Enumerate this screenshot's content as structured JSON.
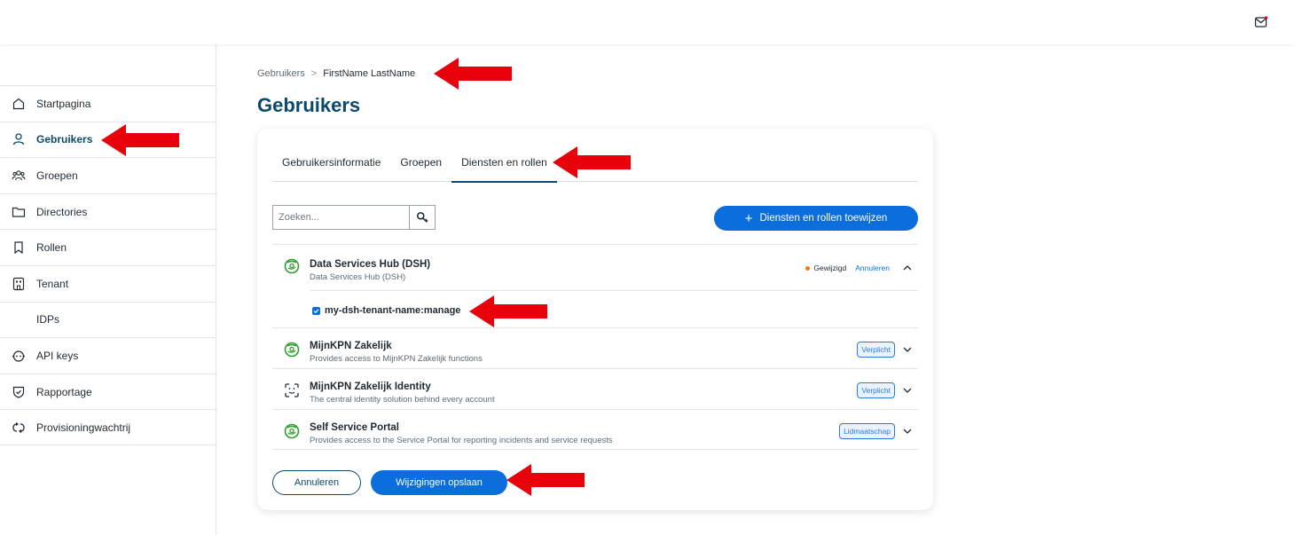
{
  "sidebar": {
    "items": [
      {
        "label": "Startpagina",
        "icon": "home-icon"
      },
      {
        "label": "Gebruikers",
        "icon": "user-icon"
      },
      {
        "label": "Groepen",
        "icon": "group-icon"
      },
      {
        "label": "Directories",
        "icon": "folder-icon"
      },
      {
        "label": "Rollen",
        "icon": "bookmark-icon"
      },
      {
        "label": "Tenant",
        "icon": "building-icon"
      },
      {
        "label": "IDPs",
        "icon": ""
      },
      {
        "label": "API keys",
        "icon": "robot-icon"
      },
      {
        "label": "Rapportage",
        "icon": "shield-check-icon"
      },
      {
        "label": "Provisioningwachtrij",
        "icon": "sync-icon"
      }
    ]
  },
  "breadcrumb": {
    "parent": "Gebruikers",
    "separator": ">",
    "current": "FirstName LastName"
  },
  "page": {
    "title": "Gebruikers"
  },
  "tabs": [
    "Gebruikersinformatie",
    "Groepen",
    "Diensten en rollen"
  ],
  "search": {
    "placeholder": "Zoeken..."
  },
  "assign_button": {
    "plus": "+",
    "label": "Diensten en rollen toewijzen"
  },
  "services": [
    {
      "name": "Data Services Hub (DSH)",
      "description": "Data Services Hub (DSH)",
      "status": "Gewijzigd",
      "cancel": "Annuleren"
    },
    {
      "name": "MijnKPN Zakelijk",
      "description": "Provides access to MijnKPN Zakelijk functions",
      "badge": "Verplicht"
    },
    {
      "name": "MijnKPN Zakelijk Identity",
      "description": "The central identity solution behind every account",
      "badge": "Verplicht"
    },
    {
      "name": "Self Service Portal",
      "description": "Provides access to the Service Portal for reporting incidents and service requests",
      "badge": "Lidmaatschap"
    }
  ],
  "role": {
    "label": "my-dsh-tenant-name:manage"
  },
  "actions": {
    "cancel": "Annuleren",
    "save": "Wijzigingen opslaan"
  },
  "colors": {
    "primary": "#0b6edc",
    "heading": "#0b4a6b",
    "annotation_arrow": "#e8000b",
    "status_dot": "#f07a18",
    "service_logo": "#2f9e2f"
  }
}
